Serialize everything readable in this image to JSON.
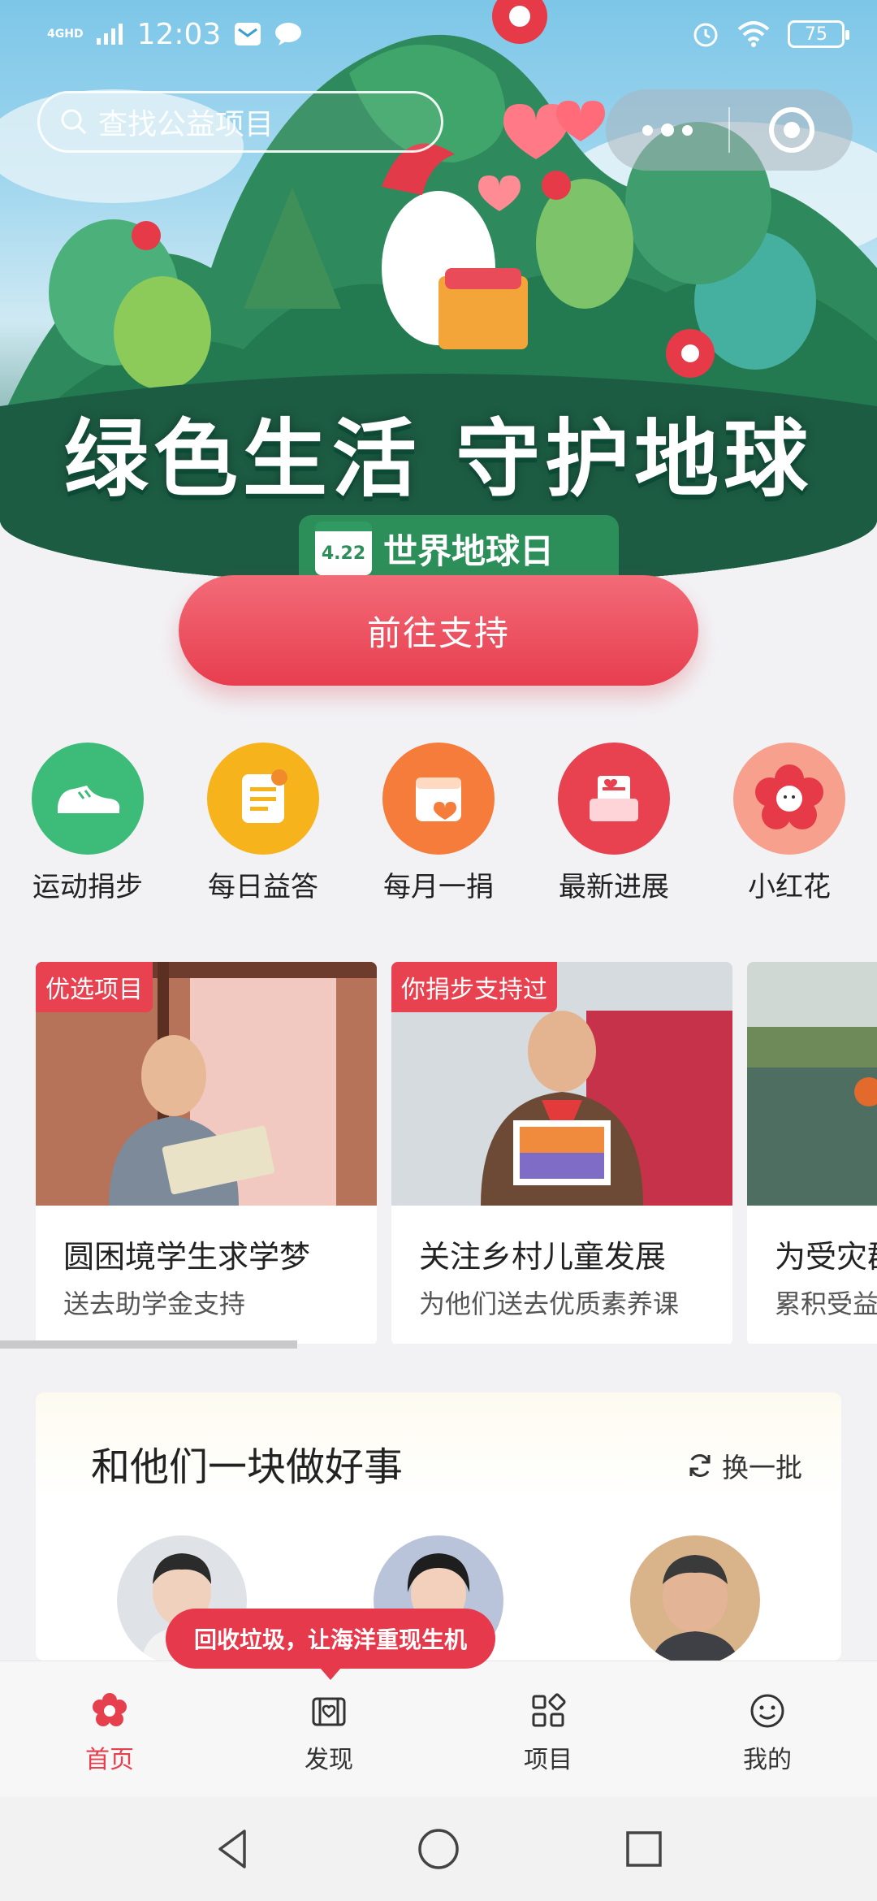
{
  "status_bar": {
    "network": "4GHD",
    "time": "12:03",
    "battery": "75"
  },
  "search": {
    "placeholder": "查找公益项目"
  },
  "banner": {
    "headline": "绿色生活 守护地球",
    "date_badge": "4.22",
    "event_label": "世界地球日",
    "cta_label": "前往支持"
  },
  "quick_entries": [
    {
      "label": "运动捐步",
      "icon": "sneaker-icon",
      "color": "#3dbb78"
    },
    {
      "label": "每日益答",
      "icon": "quiz-icon",
      "color": "#f6b31c"
    },
    {
      "label": "每月一捐",
      "icon": "calendar-icon",
      "color": "#f57c3a"
    },
    {
      "label": "最新进展",
      "icon": "inbox-icon",
      "color": "#e8414f"
    },
    {
      "label": "小红花",
      "icon": "red-flower-icon",
      "color": "#f7a08d"
    }
  ],
  "projects": [
    {
      "tag": "优选项目",
      "title": "圆困境学生求学梦",
      "subtitle": "送去助学金支持"
    },
    {
      "tag": "你捐步支持过",
      "title": "关注乡村儿童发展",
      "subtitle": "为他们送去优质素养课"
    },
    {
      "tag": "",
      "title": "为受灾群",
      "subtitle": "累积受益"
    }
  ],
  "together": {
    "title": "和他们一块做好事",
    "refresh_label": "换一批"
  },
  "toast": "回收垃圾，让海洋重现生机",
  "tabbar": [
    {
      "label": "首页",
      "icon": "flower-icon",
      "active": true
    },
    {
      "label": "发现",
      "icon": "discover-icon",
      "active": false
    },
    {
      "label": "项目",
      "icon": "grid-icon",
      "active": false
    },
    {
      "label": "我的",
      "icon": "smiley-icon",
      "active": false
    }
  ],
  "colors": {
    "accent": "#e8414f",
    "banner_green": "#1f6a4f"
  }
}
